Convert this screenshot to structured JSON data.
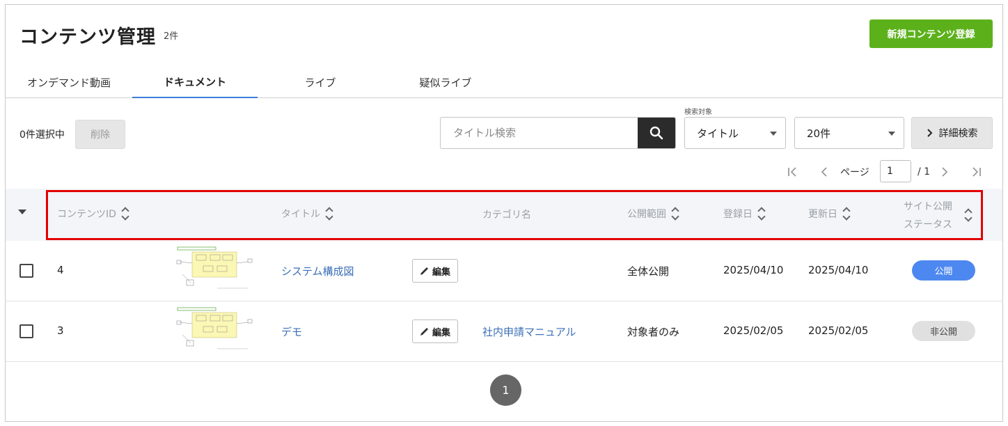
{
  "header": {
    "title": "コンテンツ管理",
    "count": "2件",
    "new_button": "新規コンテンツ登録"
  },
  "tabs": [
    {
      "label": "オンデマンド動画",
      "active": false
    },
    {
      "label": "ドキュメント",
      "active": true
    },
    {
      "label": "ライブ",
      "active": false
    },
    {
      "label": "疑似ライブ",
      "active": false
    }
  ],
  "toolbar": {
    "selected_count": "0件選択中",
    "delete_label": "削除",
    "search_placeholder": "タイトル検索",
    "search_target_label": "検索対象",
    "search_target_value": "タイトル",
    "per_page_value": "20件",
    "advanced_search_label": "詳細検索"
  },
  "pagination_top": {
    "page_label": "ページ",
    "current_page": "1",
    "total": "/ 1"
  },
  "table": {
    "columns": {
      "id": "コンテンツID",
      "title": "タイトル",
      "category": "カテゴリ名",
      "scope": "公開範囲",
      "created": "登録日",
      "updated": "更新日",
      "status_line1": "サイト公開",
      "status_line2": "ステータス"
    },
    "edit_label": "編集",
    "rows": [
      {
        "id": "4",
        "title": "システム構成図",
        "category": "",
        "scope": "全体公開",
        "created": "2025/04/10",
        "updated": "2025/04/10",
        "status": "公開"
      },
      {
        "id": "3",
        "title": "デモ",
        "category": "社内申請マニュアル",
        "scope": "対象者のみ",
        "created": "2025/02/05",
        "updated": "2025/02/05",
        "status": "非公開"
      }
    ]
  },
  "pagination_bottom": {
    "page": "1"
  },
  "colors": {
    "accent_green": "#5cb11b",
    "public_badge": "#4d88f0",
    "private_badge": "#e0e0e0",
    "link": "#3b6fb6",
    "highlight": "#e30000"
  }
}
